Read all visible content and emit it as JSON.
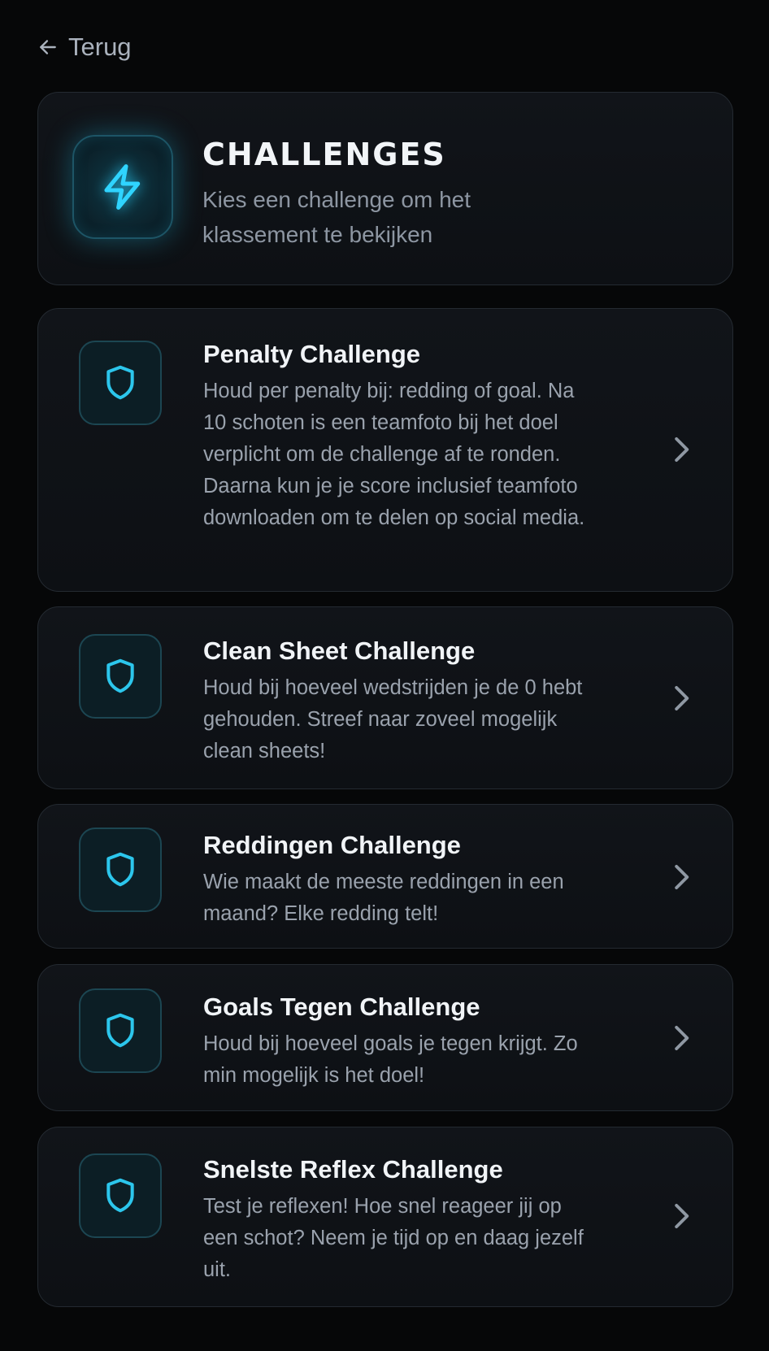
{
  "nav": {
    "back_label": "Terug"
  },
  "header": {
    "title": "CHALLENGES",
    "subtitle": "Kies een challenge om het klassement te bekijken",
    "icon": "lightning-icon"
  },
  "challenges": [
    {
      "title": "Penalty Challenge",
      "description": "Houd per penalty bij: redding of goal. Na 10 schoten is een teamfoto bij het doel verplicht om de challenge af te ronden. Daarna kun je je score inclusief teamfoto downloaden om te delen op social media.",
      "icon": "shield-icon"
    },
    {
      "title": "Clean Sheet Challenge",
      "description": "Houd bij hoeveel wedstrijden je de 0 hebt gehouden. Streef naar zoveel mogelijk clean sheets!",
      "icon": "shield-icon"
    },
    {
      "title": "Reddingen Challenge",
      "description": "Wie maakt de meeste reddingen in een maand? Elke redding telt!",
      "icon": "shield-icon"
    },
    {
      "title": "Goals Tegen Challenge",
      "description": "Houd bij hoeveel goals je tegen krijgt. Zo min mogelijk is het doel!",
      "icon": "shield-icon"
    },
    {
      "title": "Snelste Reflex Challenge",
      "description": "Test je reflexen! Hoe snel reageer jij op een schot? Neem je tijd op en daag jezelf uit.",
      "icon": "shield-icon"
    }
  ],
  "colors": {
    "background": "#060708",
    "card": "#101317",
    "accent": "#27c8ee",
    "text_primary": "#f1f4f7",
    "text_secondary": "#9aa2ad"
  }
}
